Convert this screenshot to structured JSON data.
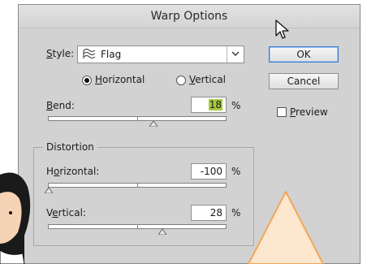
{
  "dialog": {
    "title": "Warp Options",
    "style": {
      "label_first": "S",
      "label_rest": "tyle:",
      "value": "Flag",
      "icon": "flag-warp-icon"
    },
    "orientation": {
      "horizontal": {
        "first": "H",
        "rest": "orizontal",
        "selected": true
      },
      "vertical": {
        "first": "V",
        "rest": "ertical",
        "selected": false
      }
    },
    "bend": {
      "label_first": "B",
      "label_rest": "end:",
      "value": "18",
      "unit": "%",
      "slider_percent": 18
    },
    "distortion": {
      "legend": "Distortion",
      "horizontal": {
        "pre": "H",
        "u": "o",
        "post": "rizontal:",
        "value": "-100",
        "unit": "%",
        "slider_percent": -100
      },
      "vertical": {
        "pre": "V",
        "u": "e",
        "post": "rtical:",
        "value": "28",
        "unit": "%",
        "slider_percent": 28
      }
    },
    "buttons": {
      "ok": "OK",
      "cancel": "Cancel"
    },
    "preview": {
      "first": "P",
      "rest": "review",
      "checked": false
    }
  }
}
